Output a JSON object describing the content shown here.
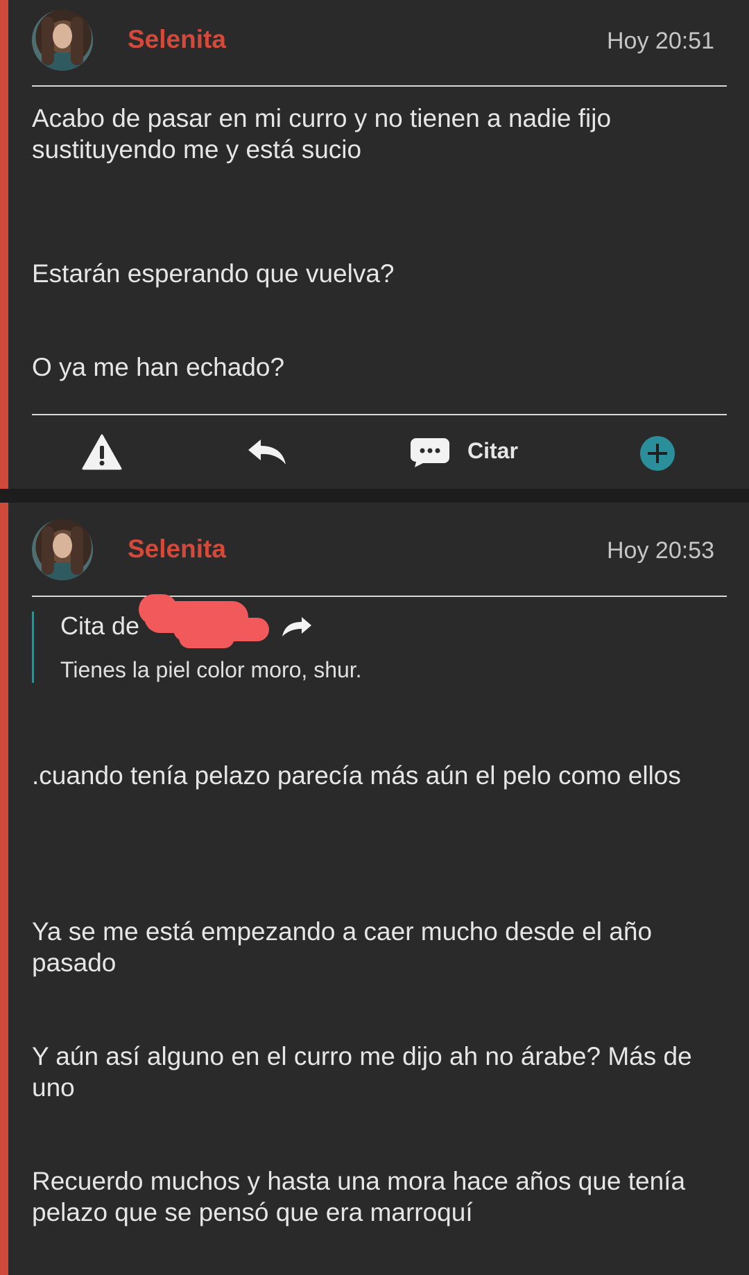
{
  "colors": {
    "accent": "#cf4a3a",
    "username": "#d4493a",
    "quote_border": "#3a8b92",
    "plus_button": "#2b8f9b",
    "redaction": "#f2595a"
  },
  "posts": [
    {
      "username": "Selenita",
      "timestamp": "Hoy 20:51",
      "paragraphs": [
        "Acabo de pasar en mi curro y no tienen a nadie fijo sustituyendo me y está sucio",
        "Estarán esperando que vuelva?",
        "O ya me han echado?"
      ],
      "actions": {
        "report_icon": "warning-icon",
        "reply_icon": "reply-arrow-icon",
        "quote_icon": "speech-bubble-icon",
        "quote_label": "Citar",
        "more_icon": "plus-circle-icon"
      }
    },
    {
      "username": "Selenita",
      "timestamp": "Hoy 20:53",
      "quote": {
        "label": "Cita de",
        "text": "Tienes la piel color moro, shur."
      },
      "paragraphs": [
        ".cuando tenía pelazo parecía más aún el pelo como ellos",
        "Ya se me está empezando a caer mucho desde el año pasado",
        "Y aún así alguno en el curro me dijo ah no árabe? Más de uno",
        "Recuerdo muchos y hasta una mora hace años que tenía pelazo que se pensó que era marroquí"
      ]
    }
  ]
}
